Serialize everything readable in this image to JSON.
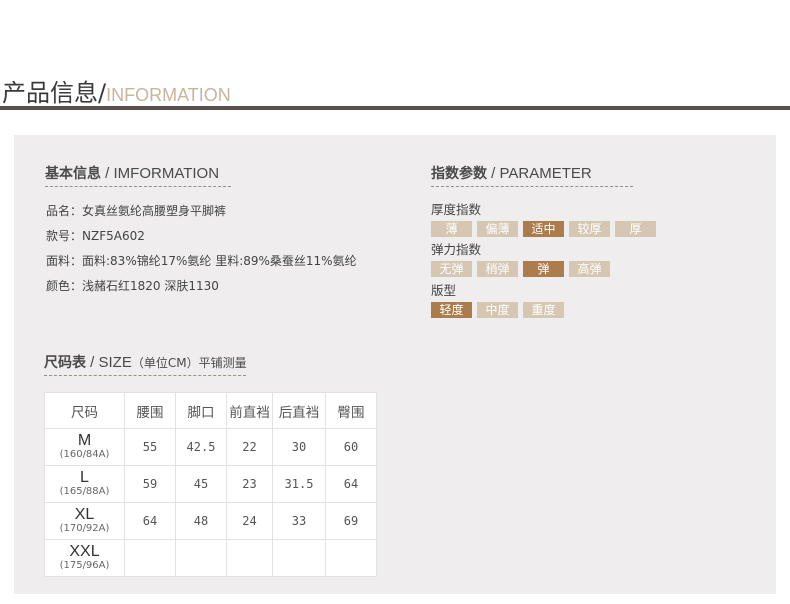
{
  "header": {
    "title_cn": "产品信息/",
    "title_en": "INFORMATION"
  },
  "basic": {
    "title_cn": "基本信息",
    "title_en": " / IMFORMATION",
    "lines": [
      "品名：女真丝氨纶高腰塑身平脚裤",
      "款号：NZF5A602",
      "面料：面料:83%锦纶17%氨纶 里料:89%桑蚕丝11%氨纶",
      "颜色：浅赭石红1820  深肤1130"
    ]
  },
  "params": {
    "title_cn": "指数参数",
    "title_en": " / PARAMETER",
    "groups": [
      {
        "label": "厚度指数",
        "options": [
          "薄",
          "偏薄",
          "适中",
          "较厚",
          "厚"
        ],
        "selected": "适中"
      },
      {
        "label": "弹力指数",
        "options": [
          "无弹",
          "稍弹",
          "弹",
          "高弹"
        ],
        "selected": "弹"
      },
      {
        "label": "版型",
        "options": [
          "轻度",
          "中度",
          "重度"
        ],
        "selected": "轻度"
      }
    ]
  },
  "size": {
    "title_cn": "尺码表",
    "title_en": " / SIZE",
    "title_unit": "（单位CM）",
    "title_suffix": "平铺测量",
    "headers": [
      "尺码",
      "腰围",
      "脚口",
      "前直裆",
      "后直裆",
      "臀围"
    ],
    "rows": [
      {
        "size": "M",
        "spec": "(160/84A)",
        "values": [
          "55",
          "42.5",
          "22",
          "30",
          "60"
        ]
      },
      {
        "size": "L",
        "spec": "(165/88A)",
        "values": [
          "59",
          "45",
          "23",
          "31.5",
          "64"
        ]
      },
      {
        "size": "XL",
        "spec": "(170/92A)",
        "values": [
          "64",
          "48",
          "24",
          "33",
          "69"
        ]
      },
      {
        "size": "XXL",
        "spec": "(175/96A)",
        "values": [
          "",
          "",
          "",
          "",
          ""
        ]
      }
    ]
  },
  "colors": {
    "chip_on": "#ad7c4d",
    "chip_off": "#d6c7b2",
    "panel": "#efedee",
    "rule": "#5a4f4f"
  }
}
